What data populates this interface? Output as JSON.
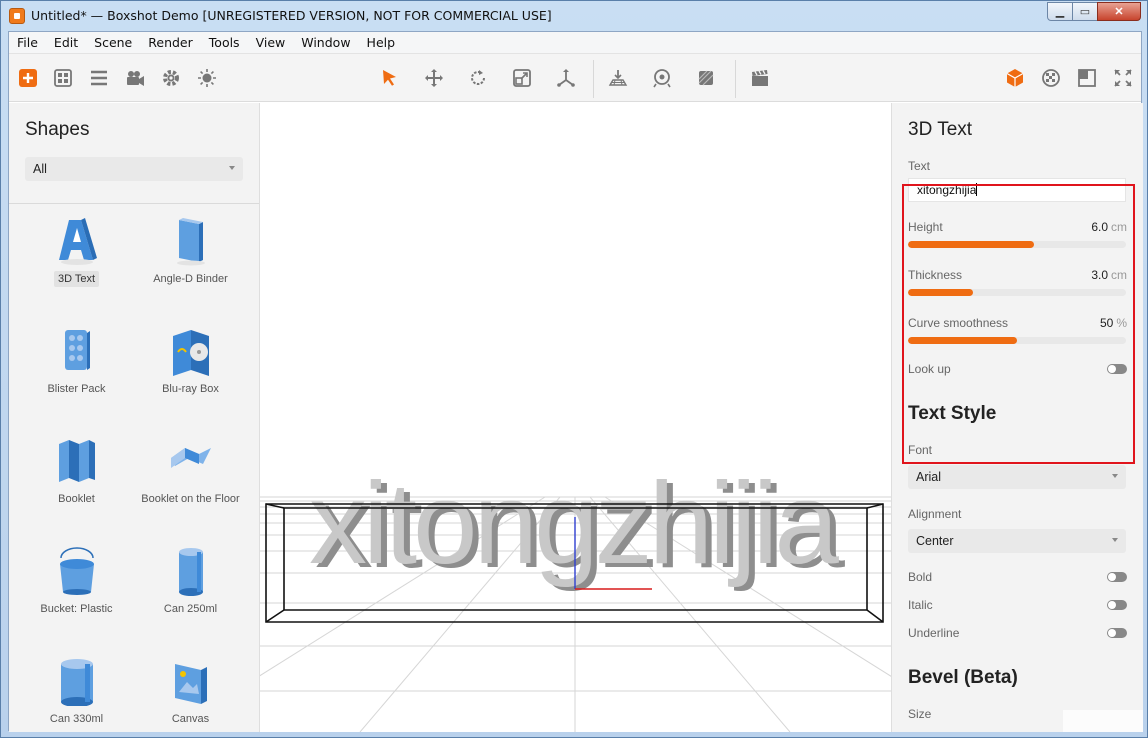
{
  "window": {
    "title": "Untitled* — Boxshot Demo [UNREGISTERED VERSION, NOT FOR COMMERCIAL USE]",
    "minimize": "▁",
    "maximize": "▭",
    "close": "✕"
  },
  "menu": [
    "File",
    "Edit",
    "Scene",
    "Render",
    "Tools",
    "View",
    "Window",
    "Help"
  ],
  "toolbar": {
    "left": [
      "add-icon",
      "grid-icon",
      "list-icon",
      "camera-icon",
      "gear-icon",
      "light-icon"
    ],
    "center": [
      "pointer-icon",
      "move-icon",
      "rotate-icon",
      "scale-icon",
      "axis-icon"
    ],
    "center2": [
      "floor-icon",
      "orbit-icon",
      "material-icon"
    ],
    "center3": [
      "clapper-icon"
    ],
    "right": [
      "shape-cube-icon",
      "texture-icon",
      "frame-icon",
      "fullscreen-icon"
    ]
  },
  "left_panel": {
    "title": "Shapes",
    "filter": "All",
    "shapes": [
      {
        "label": "3D Text",
        "icon": "text-3d-icon",
        "selected": true
      },
      {
        "label": "Angle-D Binder",
        "icon": "binder-icon",
        "selected": false
      },
      {
        "label": "Blister Pack",
        "icon": "blister-icon",
        "selected": false
      },
      {
        "label": "Blu-ray Box",
        "icon": "bluray-icon",
        "selected": false
      },
      {
        "label": "Booklet",
        "icon": "booklet-icon",
        "selected": false
      },
      {
        "label": "Booklet on the Floor",
        "icon": "booklet-floor-icon",
        "selected": false
      },
      {
        "label": "Bucket: Plastic",
        "icon": "bucket-icon",
        "selected": false
      },
      {
        "label": "Can 250ml",
        "icon": "can-icon",
        "selected": false
      },
      {
        "label": "Can 330ml",
        "icon": "can-icon",
        "selected": false
      },
      {
        "label": "Canvas",
        "icon": "canvas-icon",
        "selected": false
      }
    ]
  },
  "viewport": {
    "text": "xitongzhijia"
  },
  "right_panel": {
    "section1": "3D Text",
    "text_label": "Text",
    "text_value": "xitongzhijia",
    "height": {
      "label": "Height",
      "value": "6.0",
      "unit": "cm",
      "fraction": 0.58
    },
    "thickness": {
      "label": "Thickness",
      "value": "3.0",
      "unit": "cm",
      "fraction": 0.3
    },
    "curve": {
      "label": "Curve smoothness",
      "value": "50",
      "unit": "%",
      "fraction": 0.5
    },
    "look_up": "Look up",
    "section2": "Text Style",
    "font_label": "Font",
    "font_value": "Arial",
    "alignment_label": "Alignment",
    "alignment_value": "Center",
    "bold": "Bold",
    "italic": "Italic",
    "underline": "Underline",
    "section3": "Bevel (Beta)",
    "size_label": "Size"
  },
  "colors": {
    "accent": "#ef6c12",
    "highlight": "#e0141c"
  }
}
